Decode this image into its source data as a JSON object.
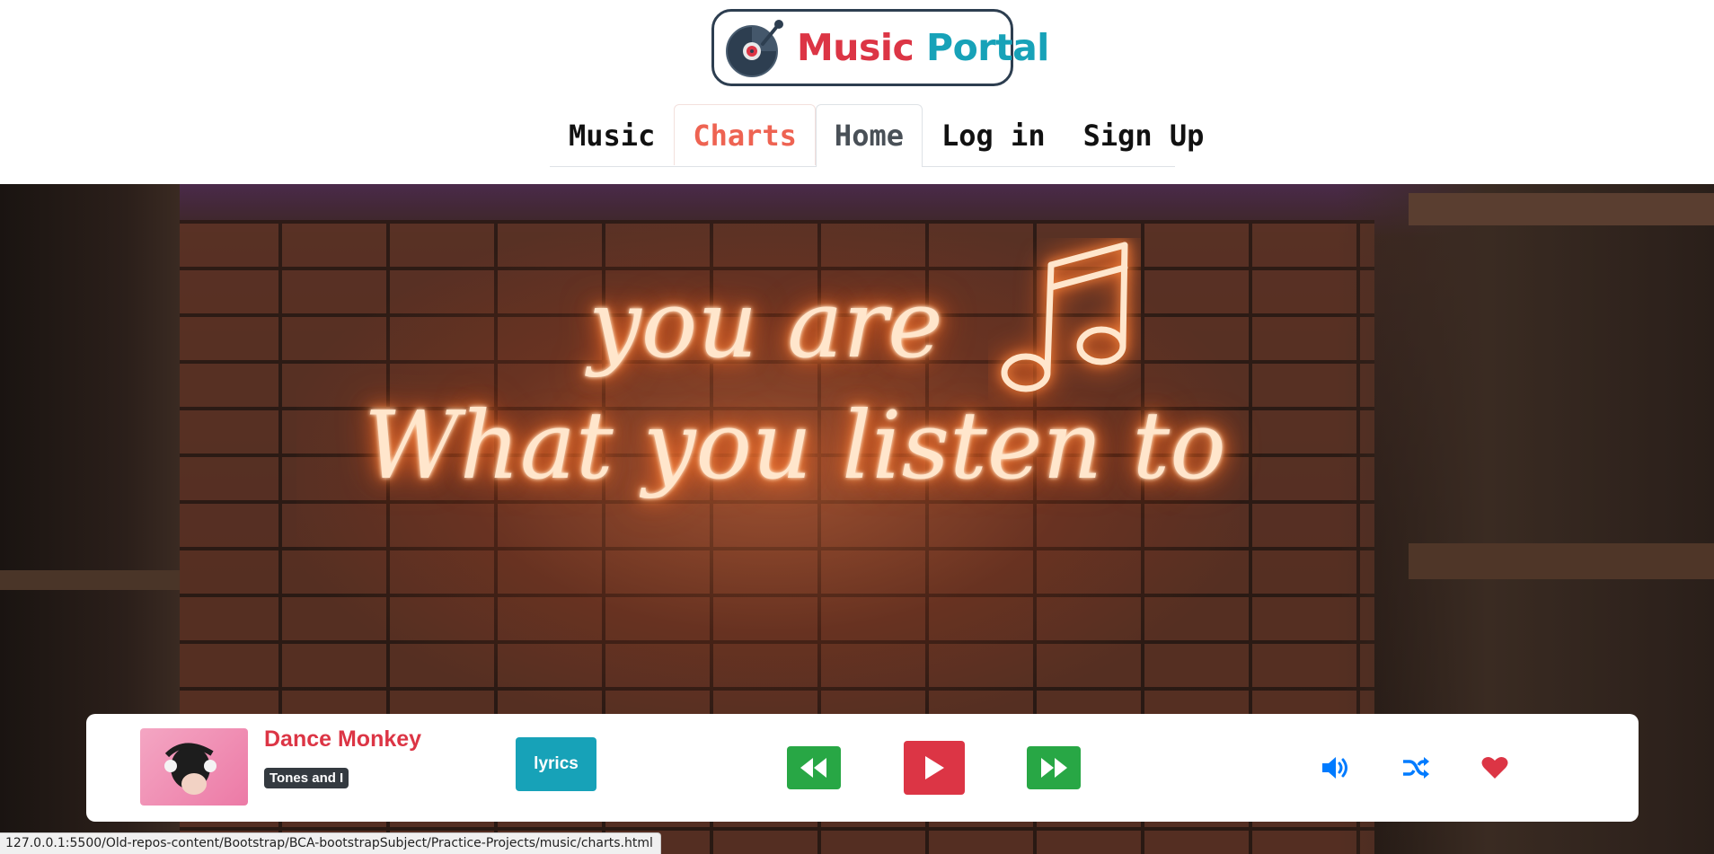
{
  "logo": {
    "word1": "Music",
    "word2": "Portal",
    "colors": {
      "word1": "#dc3545",
      "word2": "#17a2b8",
      "border": "#2d3e50"
    },
    "icon": "record-player-icon"
  },
  "nav": {
    "items": [
      {
        "label": "Music"
      },
      {
        "label": "Charts"
      },
      {
        "label": "Home"
      },
      {
        "label": "Log in"
      },
      {
        "label": "Sign Up"
      }
    ]
  },
  "hero": {
    "neon_line1": "you are",
    "neon_line2": "What you listen to",
    "icon": "music-note-icon"
  },
  "player": {
    "song_title": "Dance Monkey",
    "artist": "Tones and I",
    "lyrics_label": "lyrics",
    "icons": {
      "prev": "fast-backward-icon",
      "play": "play-icon",
      "next": "fast-forward-icon",
      "volume": "volume-icon",
      "shuffle": "shuffle-icon",
      "favorite": "heart-icon"
    },
    "colors": {
      "title": "#dc3545",
      "lyrics": "#17a2b8",
      "skip": "#28a745",
      "play": "#dc3545",
      "tools_blue": "#007bff",
      "heart": "#dc3545"
    }
  },
  "status_bar": {
    "url": "127.0.0.1:5500/Old-repos-content/Bootstrap/BCA-bootstrapSubject/Practice-Projects/music/charts.html"
  }
}
